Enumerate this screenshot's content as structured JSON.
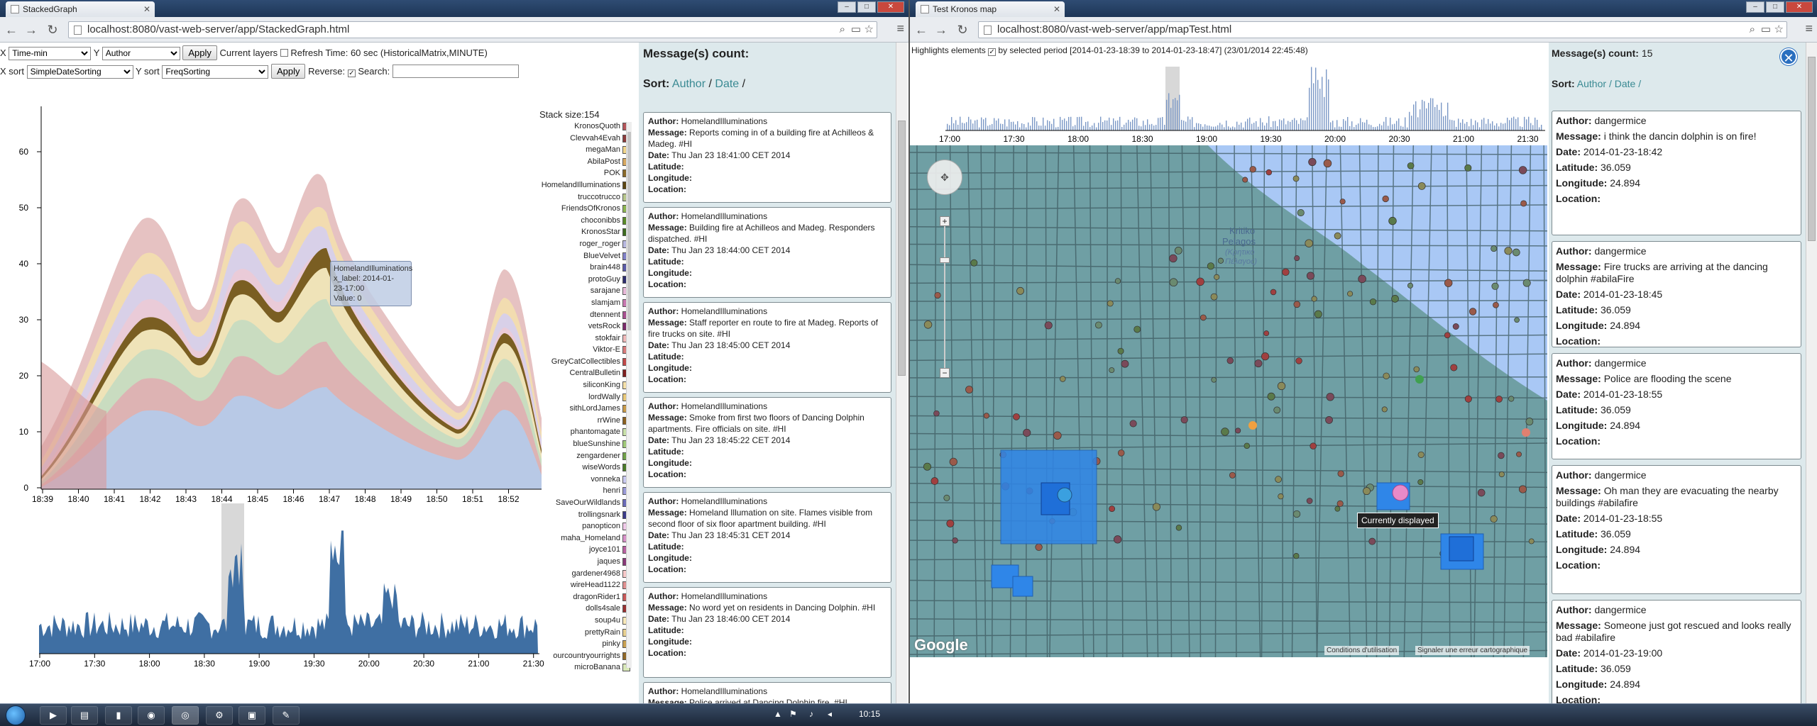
{
  "left": {
    "tab_title": "StackedGraph",
    "url": "localhost:8080/vast-web-server/app/StackedGraph.html",
    "controls": {
      "x_label": "X",
      "x_value": "Time-min",
      "y_label": "Y",
      "y_value": "Author",
      "apply1": "Apply",
      "current_layers": "Current layers",
      "refresh": "Refresh Time: 60 sec (HistoricalMatrix,MINUTE)",
      "xsort_label": "X sort",
      "xsort_value": "SimpleDateSorting",
      "ysort_label": "Y sort",
      "ysort_value": "FreqSorting",
      "apply2": "Apply",
      "reverse": "Reverse:",
      "search": "Search:"
    },
    "stack_size": "Stack size:154",
    "y_ticks": [
      "60",
      "50",
      "40",
      "30",
      "20",
      "10",
      "0"
    ],
    "x_ticks": [
      "18:39",
      "18:40",
      "18:41",
      "18:42",
      "18:43",
      "18:44",
      "18:45",
      "18:46",
      "18:47",
      "18:48",
      "18:49",
      "18:50",
      "18:51",
      "18:52"
    ],
    "bottom_x_ticks": [
      "17:00",
      "17:30",
      "18:00",
      "18:30",
      "19:00",
      "19:30",
      "20:00",
      "20:30",
      "21:00",
      "21:30"
    ],
    "tooltip": {
      "l1": "HomelandIlluminations",
      "l2": "x_label: 2014-01-",
      "l3": "23-17:00",
      "l4": "Value: 0"
    },
    "legend": [
      {
        "name": "KronosQuoth",
        "color": "#b5555a"
      },
      {
        "name": "Clevvah4Evah",
        "color": "#8c3a3a"
      },
      {
        "name": "megaMan",
        "color": "#f0d58a"
      },
      {
        "name": "AbilaPost",
        "color": "#d8a860"
      },
      {
        "name": "POK",
        "color": "#8a6a2a"
      },
      {
        "name": "HomelandIlluminations",
        "color": "#5c4612"
      },
      {
        "name": "truccotrucco",
        "color": "#b7c68a"
      },
      {
        "name": "FriendsOfKronos",
        "color": "#8db550"
      },
      {
        "name": "choconibbs",
        "color": "#5a8a28"
      },
      {
        "name": "KronosStar",
        "color": "#3e6b1f"
      },
      {
        "name": "roger_roger",
        "color": "#b8b8e0"
      },
      {
        "name": "BlueVelvet",
        "color": "#8080c8"
      },
      {
        "name": "brain448",
        "color": "#5a5aa8"
      },
      {
        "name": "protoGuy",
        "color": "#2e2e6e"
      },
      {
        "name": "sarajane",
        "color": "#e8b8d8"
      },
      {
        "name": "slamjam",
        "color": "#c878b0"
      },
      {
        "name": "dtennent",
        "color": "#a85090"
      },
      {
        "name": "vetsRock",
        "color": "#7a2a6a"
      },
      {
        "name": "stokfair",
        "color": "#f0b8b8"
      },
      {
        "name": "Viktor-E",
        "color": "#d87a7a"
      },
      {
        "name": "GreyCatCollectibles",
        "color": "#c04848"
      },
      {
        "name": "CentralBulletin",
        "color": "#7e1f1f"
      },
      {
        "name": "siliconKing",
        "color": "#f5e0a8"
      },
      {
        "name": "lordWally",
        "color": "#e8c878"
      },
      {
        "name": "sithLordJames",
        "color": "#c89a48"
      },
      {
        "name": "rrWine",
        "color": "#8a6020"
      },
      {
        "name": "phantomagate",
        "color": "#c8e0a8"
      },
      {
        "name": "blueSunshine",
        "color": "#a0c878"
      },
      {
        "name": "zengardener",
        "color": "#70a048"
      },
      {
        "name": "wiseWords",
        "color": "#4a7a28"
      },
      {
        "name": "vonneka",
        "color": "#c8c8f0"
      },
      {
        "name": "henri",
        "color": "#9a9ad8"
      },
      {
        "name": "SaveOurWildlands",
        "color": "#6a6ab8"
      },
      {
        "name": "trollingsnark",
        "color": "#3a3a88"
      },
      {
        "name": "panopticon",
        "color": "#f0c8e8"
      },
      {
        "name": "maha_Homeland",
        "color": "#d890c8"
      },
      {
        "name": "joyce101",
        "color": "#b860a0"
      },
      {
        "name": "jaques",
        "color": "#883878"
      },
      {
        "name": "gardener4968",
        "color": "#f8c8c8"
      },
      {
        "name": "wireHead1122",
        "color": "#e09090"
      },
      {
        "name": "dragonRider1",
        "color": "#c85858"
      },
      {
        "name": "dolls4sale",
        "color": "#983030"
      },
      {
        "name": "soup4u",
        "color": "#f8e8b8"
      },
      {
        "name": "prettyRain",
        "color": "#e8d090"
      },
      {
        "name": "pinky",
        "color": "#c8a050"
      },
      {
        "name": "ourcountryourrights",
        "color": "#906828"
      },
      {
        "name": "microBanana",
        "color": "#d8e8b8"
      }
    ],
    "msg_title": "Message(s) count:",
    "sort_label": "Sort:",
    "sort_author": "Author",
    "sort_sep": "/",
    "sort_date": "Date",
    "sort_sep2": "/",
    "messages": [
      {
        "author": "HomelandIlluminations",
        "message": "Reports coming in of a building fire at Achilleos & Madeg. #HI",
        "date": "Thu Jan 23 18:41:00 CET 2014"
      },
      {
        "author": "HomelandIlluminations",
        "message": "Building fire at Achilleos and Madeg. Responders dispatched. #HI",
        "date": "Thu Jan 23 18:44:00 CET 2014"
      },
      {
        "author": "HomelandIlluminations",
        "message": "Staff reporter en route to fire at Madeg. Reports of fire trucks on site. #HI",
        "date": "Thu Jan 23 18:45:00 CET 2014"
      },
      {
        "author": "HomelandIlluminations",
        "message": "Smoke from first two floors of Dancing Dolphin apartments. Fire officials on site. #HI",
        "date": "Thu Jan 23 18:45:22 CET 2014"
      },
      {
        "author": "HomelandIlluminations",
        "message": "Homeland Illumation on site. Flames visible from second floor of six floor apartment building. #HI",
        "date": "Thu Jan 23 18:45:31 CET 2014"
      },
      {
        "author": "HomelandIlluminations",
        "message": "No word yet on residents in Dancing Dolphin. #HI",
        "date": "Thu Jan 23 18:46:00 CET 2014"
      },
      {
        "author": "HomelandIlluminations",
        "message": "Police arrived at Dancing Dolphin fire. #HI",
        "date": ""
      }
    ],
    "labels": {
      "author": "Author:",
      "message": "Message:",
      "date": "Date:",
      "latitude": "Latitude:",
      "longitude": "Longitude:",
      "location": "Location:"
    }
  },
  "right": {
    "tab_title": "Test Kronos map",
    "url": "localhost:8080/vast-web-server/app/mapTest.html",
    "highlight": "Highlights elements",
    "period": "by selected period [2014-01-23-18:39 to 2014-01-23-18:47] (23/01/2014 22:45:48)",
    "timeline_ticks": [
      "17:00",
      "17:30",
      "18:00",
      "18:30",
      "19:00",
      "19:30",
      "20:00",
      "20:30",
      "21:00",
      "21:30"
    ],
    "sea_label1": "Kritiko",
    "sea_label2": "Pelagos",
    "sea_label3": "(Κρητικό",
    "sea_label4": "Πέλαγος)",
    "currently_displayed": "Currently displayed",
    "google": "Google",
    "terms": "Conditions d'utilisation",
    "report": "Signaler une erreur cartographique",
    "msg_title": "Message(s) count:",
    "msg_count": "15",
    "sort_label": "Sort:",
    "sort_author": "Author",
    "sort_sep": "/",
    "sort_date": "Date",
    "sort_sep2": "/",
    "messages": [
      {
        "author": "dangermice",
        "message": "i think the dancin dolphin is on fire!",
        "date": "2014-01-23-18:42",
        "lat": "36.059",
        "lon": "24.894"
      },
      {
        "author": "dangermice",
        "message": "Fire trucks are arriving at the dancing dolphin #abilaFire",
        "date": "2014-01-23-18:45",
        "lat": "36.059",
        "lon": "24.894"
      },
      {
        "author": "dangermice",
        "message": "Police are flooding the scene",
        "date": "2014-01-23-18:55",
        "lat": "36.059",
        "lon": "24.894"
      },
      {
        "author": "dangermice",
        "message": "Oh man they are evacuating the nearby buildings #abilafire",
        "date": "2014-01-23-18:55",
        "lat": "36.059",
        "lon": "24.894"
      },
      {
        "author": "dangermice",
        "message": "Someone just got rescued and looks really bad #abilafire",
        "date": "2014-01-23-19:00",
        "lat": "36.059",
        "lon": "24.894"
      }
    ],
    "labels": {
      "author": "Author:",
      "message": "Message:",
      "date": "Date:",
      "latitude": "Latitude:",
      "longitude": "Longitude:",
      "location": "Location:"
    }
  },
  "taskbar": {
    "time": "10:15"
  },
  "icons": {
    "back": "back-arrow-icon",
    "forward": "forward-arrow-icon",
    "reload": "reload-icon",
    "close": "close-icon",
    "menu": "hamburger-menu-icon",
    "start": "windows-start-icon"
  },
  "colors": {
    "accent": "#3a8a93",
    "panel_bg": "#dde9ec",
    "map_water": "#a9c8f5",
    "map_land": "#6f9fa4",
    "histogram": "#3f6fa3"
  }
}
